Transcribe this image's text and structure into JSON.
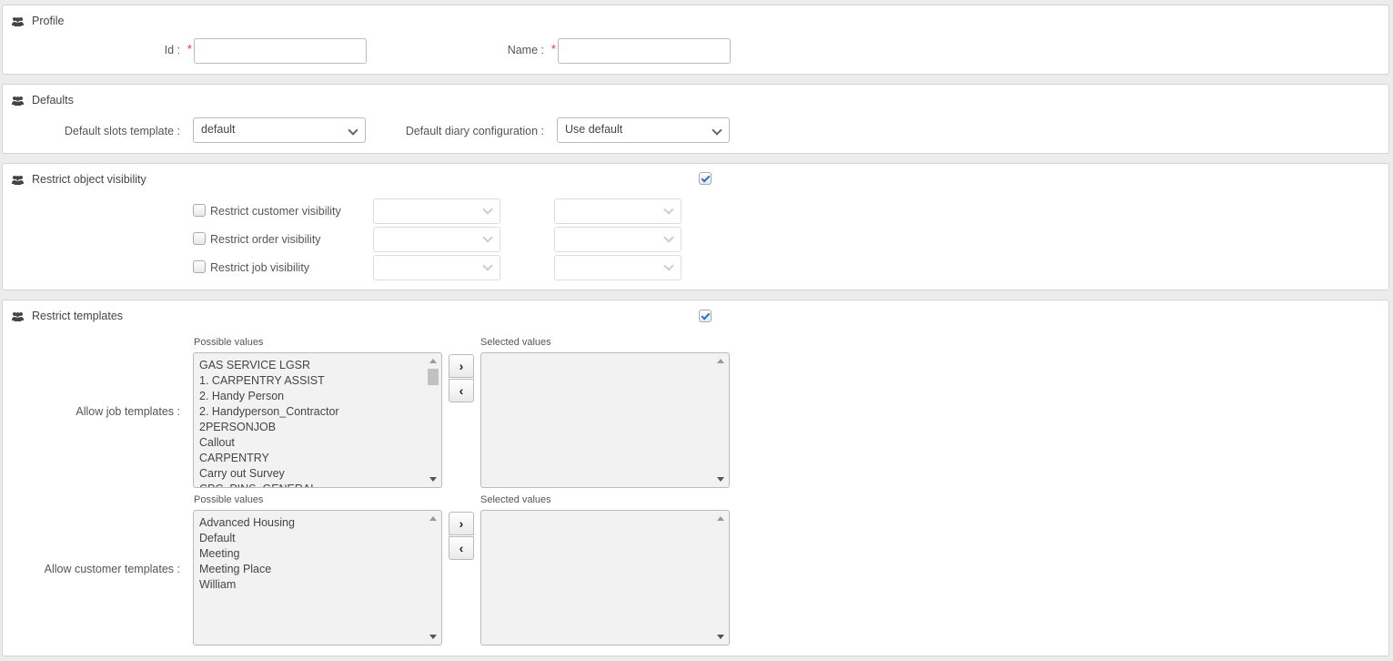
{
  "profile": {
    "title": "Profile",
    "id_label": "Id :",
    "name_label": "Name :",
    "required_mark": "*",
    "id_value": "",
    "name_value": ""
  },
  "defaults": {
    "title": "Defaults",
    "slots_label": "Default slots template :",
    "slots_value": "default",
    "diary_label": "Default diary configuration :",
    "diary_value": "Use default"
  },
  "visibility": {
    "title": "Restrict object visibility",
    "enabled": true,
    "rows": [
      {
        "label": "Restrict customer visibility",
        "checked": false
      },
      {
        "label": "Restrict order visibility",
        "checked": false
      },
      {
        "label": "Restrict job visibility",
        "checked": false
      }
    ]
  },
  "templates": {
    "title": "Restrict templates",
    "enabled": true,
    "possible_caption": "Possible values",
    "selected_caption": "Selected values",
    "add_glyph": "›",
    "remove_glyph": "‹",
    "job": {
      "label": "Allow job templates :",
      "possible": [
        "GAS SERVICE LGSR",
        "1. CARPENTRY ASSIST",
        "2. Handy Person",
        "2. Handyperson_Contractor",
        "2PERSONJOB",
        "Callout",
        "CARPENTRY",
        "Carry out Survey",
        "CPC_PINS_GENERAL"
      ],
      "selected": []
    },
    "customer": {
      "label": "Allow customer templates :",
      "possible": [
        "Advanced Housing",
        "Default",
        "Meeting",
        "Meeting Place",
        "William"
      ],
      "selected": []
    }
  }
}
